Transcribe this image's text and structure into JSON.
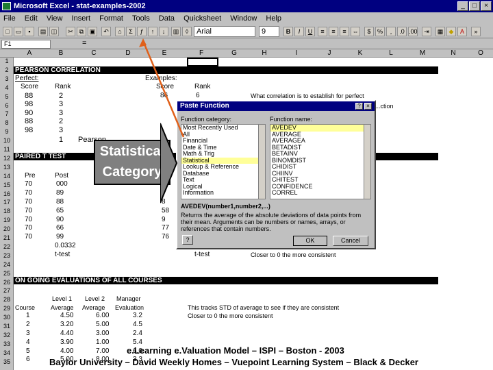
{
  "window": {
    "title": "Microsoft Excel - stat-examples-2002"
  },
  "menu": [
    "File",
    "Edit",
    "View",
    "Insert",
    "Format",
    "Tools",
    "Data",
    "Quicksheet",
    "Window",
    "Help"
  ],
  "toolbar": {
    "font": "Arial",
    "size": "9"
  },
  "formula_bar": {
    "name_box": "F1",
    "equals": "="
  },
  "columns": [
    "A",
    "B",
    "C",
    "D",
    "E",
    "F",
    "G",
    "H",
    "I",
    "J",
    "K",
    "L",
    "M",
    "N",
    "O"
  ],
  "rows": [
    "1",
    "2",
    "3",
    "4",
    "5",
    "6",
    "7",
    "8",
    "9",
    "10",
    "11",
    "12",
    "13",
    "14",
    "15",
    "16",
    "17",
    "18",
    "19",
    "20",
    "21",
    "22",
    "23",
    "24",
    "25",
    "26",
    "27",
    "28",
    "29",
    "30",
    "31",
    "32",
    "33",
    "34",
    "35"
  ],
  "sheet": {
    "pearson_title": "PEARSON CORRELATION",
    "perfect": "Perfect:",
    "score_hdr": "Score",
    "rank_hdr": "Rank",
    "pearson_scores": [
      "88",
      "98",
      "90",
      "88",
      "98"
    ],
    "pearson_ranks": [
      "2",
      "3",
      "3",
      "2",
      "3",
      "1"
    ],
    "pearson_label": "Pearson",
    "examples": "Examples:",
    "e_score_hdr": "Score",
    "f_rank_hdr": "Rank",
    "e_first_score": "86",
    "f_first_rank": "6",
    "h_note1": "What correlation is to establish for perfect",
    "h_note2": "...ction",
    "paired_title": "PAIRED T TEST",
    "pre_hdr": "Pre",
    "post_hdr": "Post",
    "pre_vals": [
      "70",
      "70",
      "70",
      "70",
      "70",
      "70",
      "70"
    ],
    "post_vals": [
      "000",
      "89",
      "88",
      "65",
      "90",
      "66",
      "99"
    ],
    "e_vals": [
      "8",
      "58",
      "9",
      "77",
      "76"
    ],
    "pvalue": "0.0332",
    "ttest": "t-test",
    "f_ttest": "t-test",
    "h_closer_to0": "Closer to 0 the more consistent",
    "ongoing_title": "ON GOING EVALUATIONS OF ALL COURSES",
    "course_hdr": "Course",
    "level1_hdr": "Level 1",
    "level2_hdr": "Level 2",
    "manager_hdr": "Manager",
    "average_hdr": "Average",
    "average2_hdr": "Average",
    "evaluation_hdr": "Evaluation",
    "courses": [
      "1",
      "2",
      "3",
      "4",
      "5",
      "6"
    ],
    "level1": [
      "4.50",
      "3.20",
      "4.40",
      "3.90",
      "4.00",
      "5.00"
    ],
    "level2": [
      "6.00",
      "5.00",
      "3.00",
      "1.00",
      "7.00",
      "8.00"
    ],
    "manager": [
      "3.2",
      "4.5",
      "2.4",
      "5.4",
      "6.0",
      "3.3"
    ],
    "tracks_note": "This tracks STD of average to see if they are consistent",
    "closer_note": "Closer to 0 the more consistent"
  },
  "dialog": {
    "title": "Paste Function",
    "category_label": "Function category:",
    "name_label": "Function name:",
    "categories": [
      "Most Recently Used",
      "All",
      "Financial",
      "Date & Time",
      "Math & Trig",
      "Statistical",
      "Lookup & Reference",
      "Database",
      "Text",
      "Logical",
      "Information"
    ],
    "functions": [
      "AVEDEV",
      "AVERAGE",
      "AVERAGEA",
      "BETADIST",
      "BETAINV",
      "BINOMDIST",
      "CHIDIST",
      "CHIINV",
      "CHITEST",
      "CONFIDENCE",
      "CORREL"
    ],
    "signature": "AVEDEV(number1,number2,...)",
    "description": "Returns the average of the absolute deviations of data points from their mean. Arguments can be numbers or names, arrays, or references that contain numbers.",
    "help_btn": "?",
    "ok": "OK",
    "cancel": "Cancel"
  },
  "callout": {
    "line1": "Statistical",
    "line2": "Category"
  },
  "footer": {
    "line1": "e.Learning e.Valuation Model – ISPI – Boston - 2003",
    "line2": "Baylor University – David Weekly Homes – Vuepoint Learning System – Black & Decker"
  },
  "colors": {
    "title_blue": "#000080",
    "arrow": "#e0601a",
    "highlight_yellow": "#ffff99",
    "chrome_gray": "#c0c0c0"
  }
}
